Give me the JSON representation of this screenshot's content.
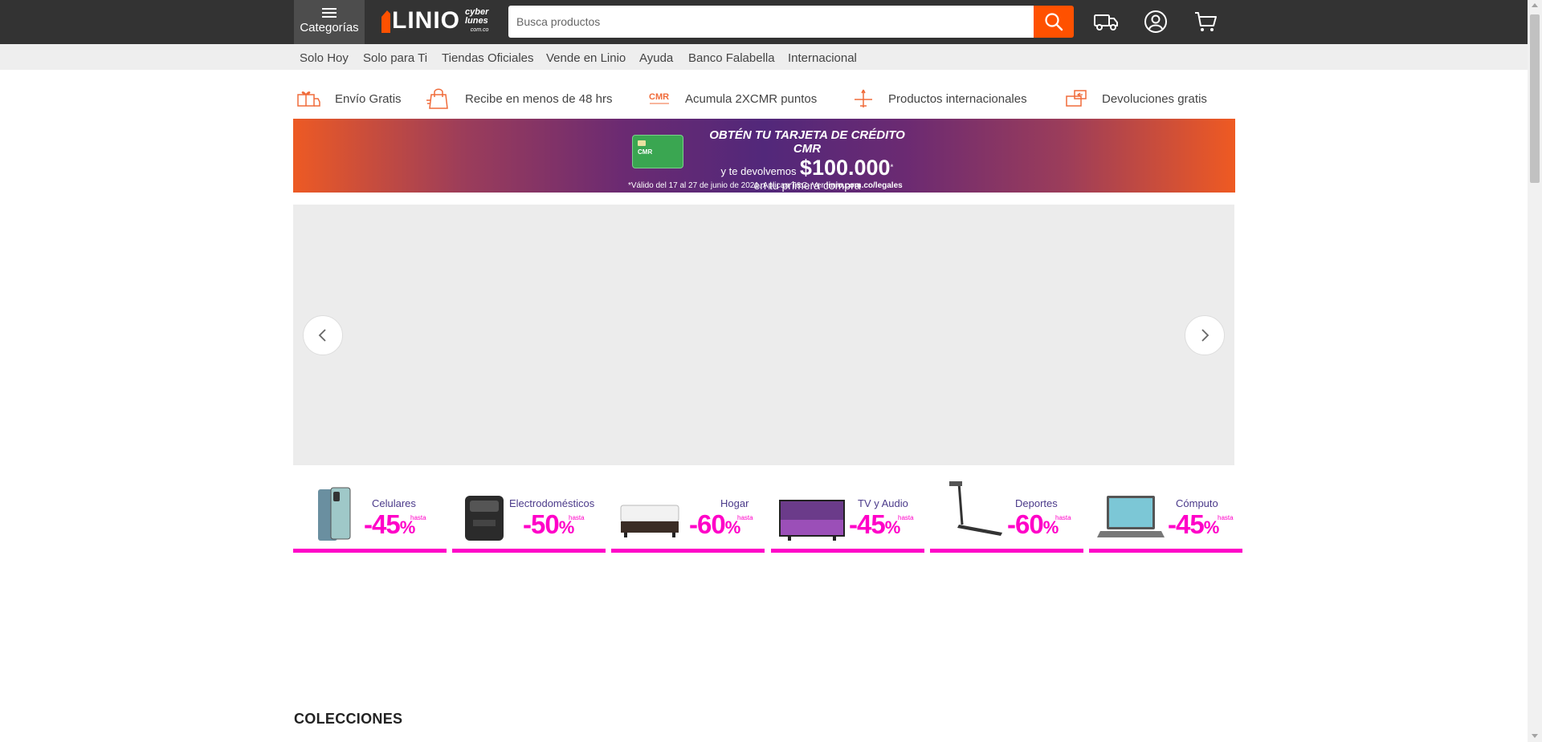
{
  "header": {
    "categories_label": "Categorías",
    "logo_text": "LINIO",
    "logo_badge_line1": "cyber",
    "logo_badge_line2": "lunes",
    "logo_badge_domain": "com.co",
    "search_placeholder": "Busca productos",
    "search_value": "",
    "icons": [
      "truck-icon",
      "user-icon",
      "cart-icon",
      "search-icon"
    ]
  },
  "subnav": {
    "items": [
      "Solo Hoy",
      "Solo para Ti",
      "Tiendas Oficiales",
      "Vende en Linio",
      "Ayuda",
      "Banco Falabella",
      "Internacional"
    ]
  },
  "benefits": {
    "items": [
      {
        "label": "Envío Gratis",
        "icon": "gift-truck-icon"
      },
      {
        "label": "Recibe en menos de 48 hrs",
        "icon": "shopping-bag-icon"
      },
      {
        "label": "Acumula 2XCMR puntos",
        "icon": "cmr-logo-icon"
      },
      {
        "label": "Productos internacionales",
        "icon": "airplane-icon"
      },
      {
        "label": "Devoluciones gratis",
        "icon": "return-box-icon"
      }
    ]
  },
  "banner": {
    "headline": "OBTÉN TU TARJETA DE CRÉDITO CMR",
    "line2": "y te devolvemos",
    "amount": "$100.000",
    "amount_mark": "*",
    "line3": "en tu primera compra",
    "legal": "*Válido del 17 al 27 de junio de 2021. Aplican T&C. Ver",
    "legal_link": "linio.com.co/legales",
    "card_brand": "CMR"
  },
  "tiles": {
    "hasta_label": "hasta",
    "items": [
      {
        "name": "Celulares",
        "discount": "-45",
        "pct": "%"
      },
      {
        "name": "Electrodomésticos",
        "discount": "-50",
        "pct": "%"
      },
      {
        "name": "Hogar",
        "discount": "-60",
        "pct": "%"
      },
      {
        "name": "TV y Audio",
        "discount": "-45",
        "pct": "%"
      },
      {
        "name": "Deportes",
        "discount": "-60",
        "pct": "%"
      },
      {
        "name": "Cómputo",
        "discount": "-45",
        "pct": "%"
      }
    ]
  },
  "sections": {
    "collections_title": "COLECCIONES"
  },
  "colors": {
    "brand_orange": "#ff5100",
    "header_bg": "#333333",
    "promo_magenta": "#ff00c8",
    "promo_purple": "#4b3a8a"
  }
}
